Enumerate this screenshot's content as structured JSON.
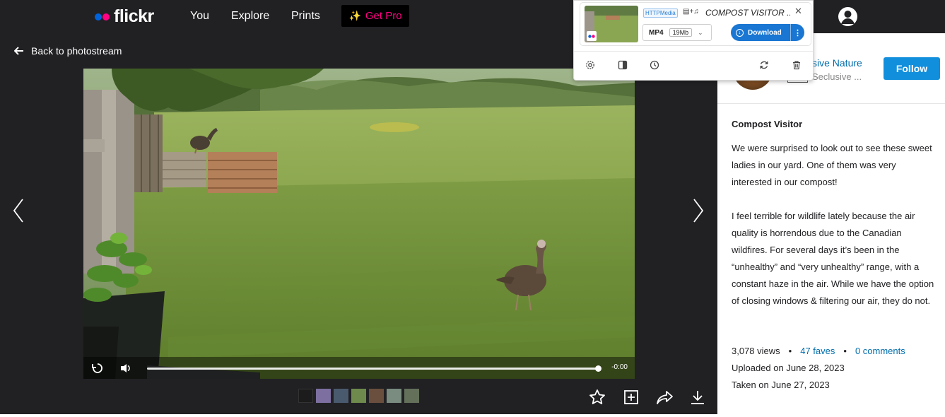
{
  "nav": {
    "logo": "flickr",
    "links": [
      "You",
      "Explore",
      "Prints"
    ],
    "get_pro": "Get Pro",
    "get_pro_icon": "sparkle-icon"
  },
  "back_link": "Back to photostream",
  "player": {
    "time": "-0:00",
    "progress": 1.0
  },
  "author": {
    "name": "sive Nature",
    "subtitle": "Seclusive ...",
    "follow": "Follow"
  },
  "photo": {
    "title": "Compost Visitor",
    "description": [
      "We were surprised to look out to see these sweet ladies in our yard. One of them was very interested in our compost!",
      "I feel terrible for wildlife lately because the air quality is horrendous due to the Canadian wildfires. For several days it’s been in the “unhealthy” and “very unhealthy” range, with a constant haze in the air. While we have the option of closing windows & filtering our air, they do not."
    ],
    "views": "3,078 views",
    "faves": "47 faves",
    "comments": "0 comments",
    "uploaded": "Uploaded on June 28, 2023",
    "taken": "Taken on June 27, 2023"
  },
  "extension": {
    "badge": "HTTPMedia",
    "title": "COMPOST VISITOR ...",
    "format": "MP4",
    "size": "19Mb",
    "download": "Download"
  },
  "colors": {
    "dark_bg": "#212124",
    "flickr_blue": "#0063dc",
    "flickr_pink": "#ff0084",
    "link_blue": "#006dac",
    "follow_blue": "#128fdc",
    "download_blue": "#1976d2"
  }
}
